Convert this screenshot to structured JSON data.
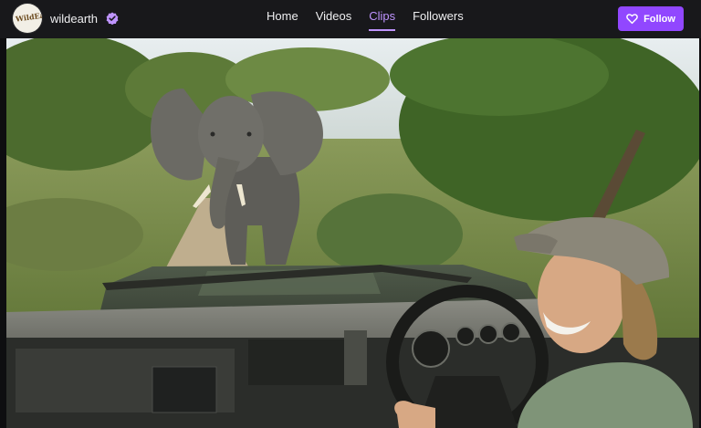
{
  "channel": {
    "name": "wildearth",
    "avatar_text": "WildEarth",
    "verified_icon": "verified-badge-icon"
  },
  "nav": {
    "tabs": [
      {
        "label": "Home",
        "active": false
      },
      {
        "label": "Videos",
        "active": false
      },
      {
        "label": "Clips",
        "active": true
      },
      {
        "label": "Followers",
        "active": false
      }
    ]
  },
  "follow_button": {
    "label": "Follow",
    "icon": "heart-icon"
  },
  "colors": {
    "accent": "#9147ff",
    "active_tab": "#bf94ff",
    "topbar_bg": "#18181b"
  },
  "video": {
    "scene": "elephant-approaching-safari-vehicle"
  }
}
